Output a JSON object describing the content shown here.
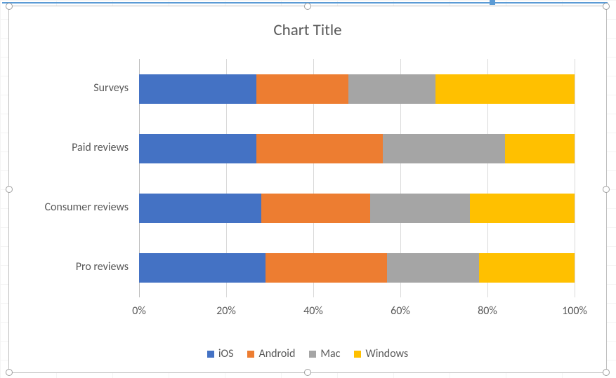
{
  "chart_data": {
    "type": "bar",
    "orientation": "horizontal-stacked-100",
    "title": "Chart Title",
    "xlabel": "",
    "ylabel": "",
    "xlim": [
      0,
      100
    ],
    "xticks": [
      "0%",
      "20%",
      "40%",
      "60%",
      "80%",
      "100%"
    ],
    "categories": [
      "Surveys",
      "Paid reviews",
      "Consumer reviews",
      "Pro reviews"
    ],
    "series": [
      {
        "name": "iOS",
        "color": "#4472C4",
        "values": [
          27,
          27,
          28,
          29
        ]
      },
      {
        "name": "Android",
        "color": "#ED7D31",
        "values": [
          21,
          29,
          25,
          28
        ]
      },
      {
        "name": "Mac",
        "color": "#A5A5A5",
        "values": [
          20,
          28,
          23,
          21
        ]
      },
      {
        "name": "Windows",
        "color": "#FFC000",
        "values": [
          32,
          16,
          24,
          22
        ]
      }
    ]
  },
  "legend": {
    "ios": "iOS",
    "android": "Android",
    "mac": "Mac",
    "windows": "Windows"
  }
}
